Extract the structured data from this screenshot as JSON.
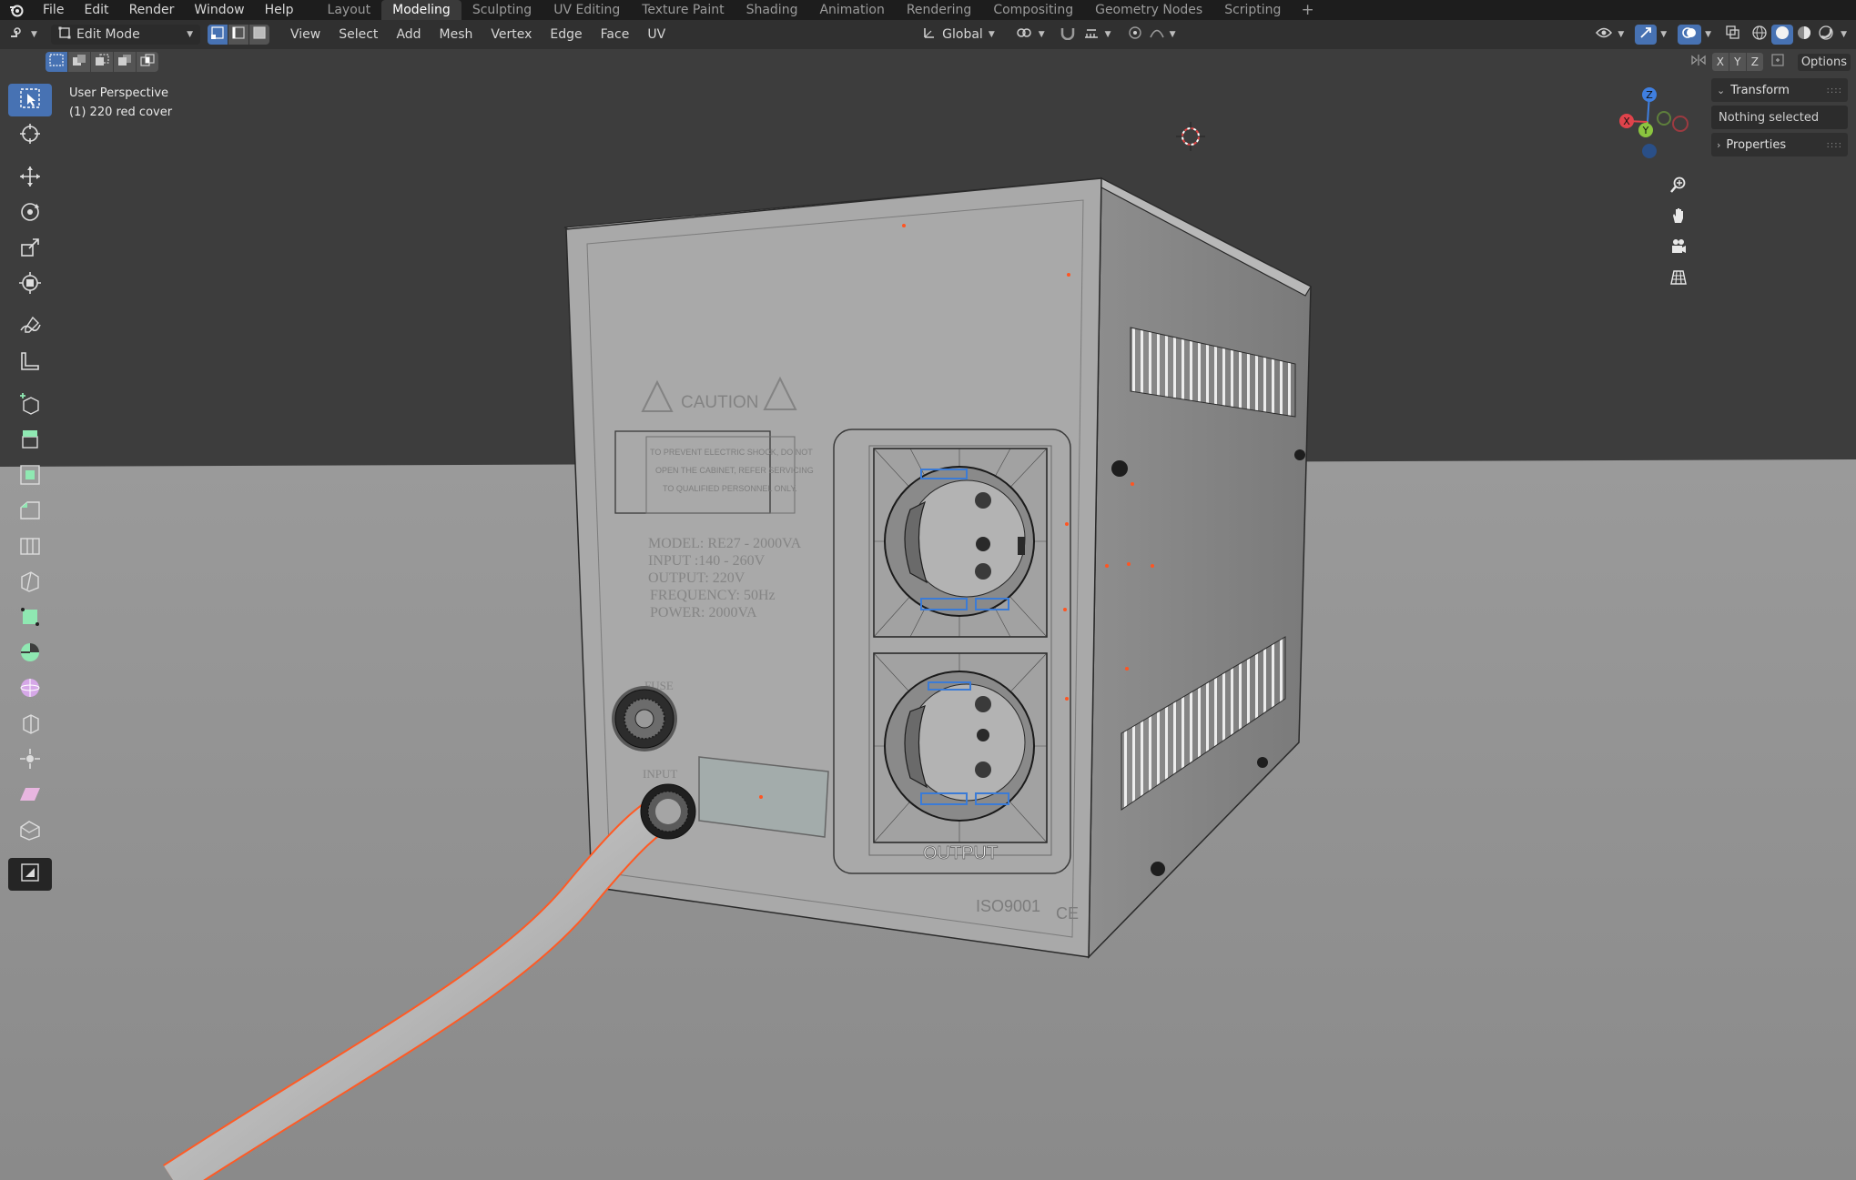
{
  "topbar": {
    "menus": [
      "File",
      "Edit",
      "Render",
      "Window",
      "Help"
    ],
    "workspaces": [
      "Layout",
      "Modeling",
      "Sculpting",
      "UV Editing",
      "Texture Paint",
      "Shading",
      "Animation",
      "Rendering",
      "Compositing",
      "Geometry Nodes",
      "Scripting"
    ],
    "active_workspace": "Modeling",
    "add_label": "+"
  },
  "header": {
    "mode": "Edit Mode",
    "menus": [
      "View",
      "Select",
      "Add",
      "Mesh",
      "Vertex",
      "Edge",
      "Face",
      "UV"
    ],
    "orientation": "Global",
    "options_label": "Options",
    "axes": [
      "X",
      "Y",
      "Z"
    ]
  },
  "viewport": {
    "view_name": "User Perspective",
    "object_label": "(1) 220 red cover"
  },
  "npanel": {
    "transform_title": "Transform",
    "nothing_selected": "Nothing selected",
    "properties_title": "Properties"
  },
  "gizmo": {
    "x": "X",
    "y": "Y",
    "z": "Z"
  },
  "device_labels": {
    "caution": "CAUTION",
    "warning_lines": [
      "TO PREVENT ELECTRIC SHOCK, DO NOT",
      "OPEN THE CABINET, REFER SERVICING",
      "TO QUALIFIED PERSONNEL ONLY."
    ],
    "spec_lines": [
      "MODEL: RE27 - 2000VA",
      "INPUT :140 - 260V",
      "OUTPUT: 220V",
      "FREQUENCY: 50Hz",
      "POWER: 2000VA"
    ],
    "fuse": "FUSE",
    "input": "INPUT",
    "output": "OUTPUT",
    "iso": "ISO9001",
    "ce": "CE"
  },
  "colors": {
    "accent": "#4772b3",
    "axis_x": "#e0434b",
    "axis_y": "#8bc53f",
    "axis_z": "#3f7fe0",
    "selection_edge": "#ff6a2b"
  }
}
